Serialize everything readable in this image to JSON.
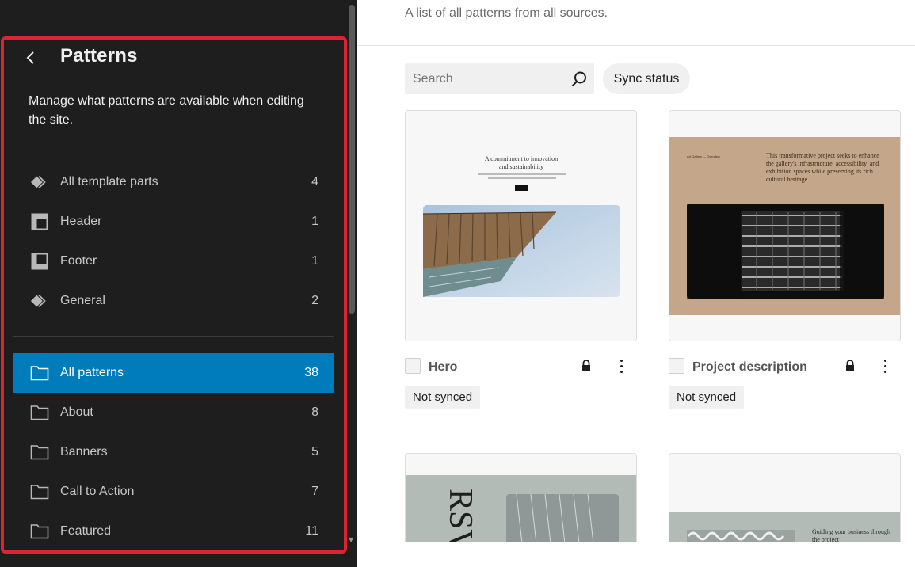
{
  "sidebar": {
    "title": "Patterns",
    "description": "Manage what patterns are available when editing the site.",
    "template_parts": [
      {
        "label": "All template parts",
        "count": "4",
        "icon": "diamond-icon"
      },
      {
        "label": "Header",
        "count": "1",
        "icon": "header-layout-icon"
      },
      {
        "label": "Footer",
        "count": "1",
        "icon": "footer-layout-icon"
      },
      {
        "label": "General",
        "count": "2",
        "icon": "diamond-icon"
      }
    ],
    "categories": [
      {
        "label": "All patterns",
        "count": "38",
        "icon": "folder-icon",
        "active": true
      },
      {
        "label": "About",
        "count": "8",
        "icon": "folder-icon"
      },
      {
        "label": "Banners",
        "count": "5",
        "icon": "folder-icon"
      },
      {
        "label": "Call to Action",
        "count": "7",
        "icon": "folder-icon"
      },
      {
        "label": "Featured",
        "count": "11",
        "icon": "folder-icon"
      }
    ]
  },
  "main": {
    "subtitle": "A list of all patterns from all sources.",
    "search": {
      "placeholder": "Search",
      "value": ""
    },
    "sync_status_label": "Sync status",
    "cards": [
      {
        "title": "Hero",
        "sync": "Not synced",
        "locked": true,
        "preview": {
          "heading_line1": "A commitment to innovation",
          "heading_line2": "and sustainability",
          "body": "Études is a pioneering firm that seamlessly merges creativity and functionality to redefine architectural excellence.",
          "button": "About us"
        }
      },
      {
        "title": "Project description",
        "sync": "Not synced",
        "locked": true,
        "preview": {
          "label": "Art Gallery — Overview",
          "text": "This transformative project seeks to enhance the gallery's infrastructure, accessibility, and exhibition spaces while preserving its rich cultural heritage."
        }
      },
      {
        "preview": {
          "big_text": "RSVP"
        }
      },
      {
        "preview": {
          "text": "Guiding your business through the project"
        }
      }
    ]
  },
  "colors": {
    "sidebar_bg": "#1e1e1e",
    "accent": "#007cba",
    "highlight": "#d9252f",
    "card_tan": "#c4a68a",
    "card_gray": "#b3bbb6"
  }
}
